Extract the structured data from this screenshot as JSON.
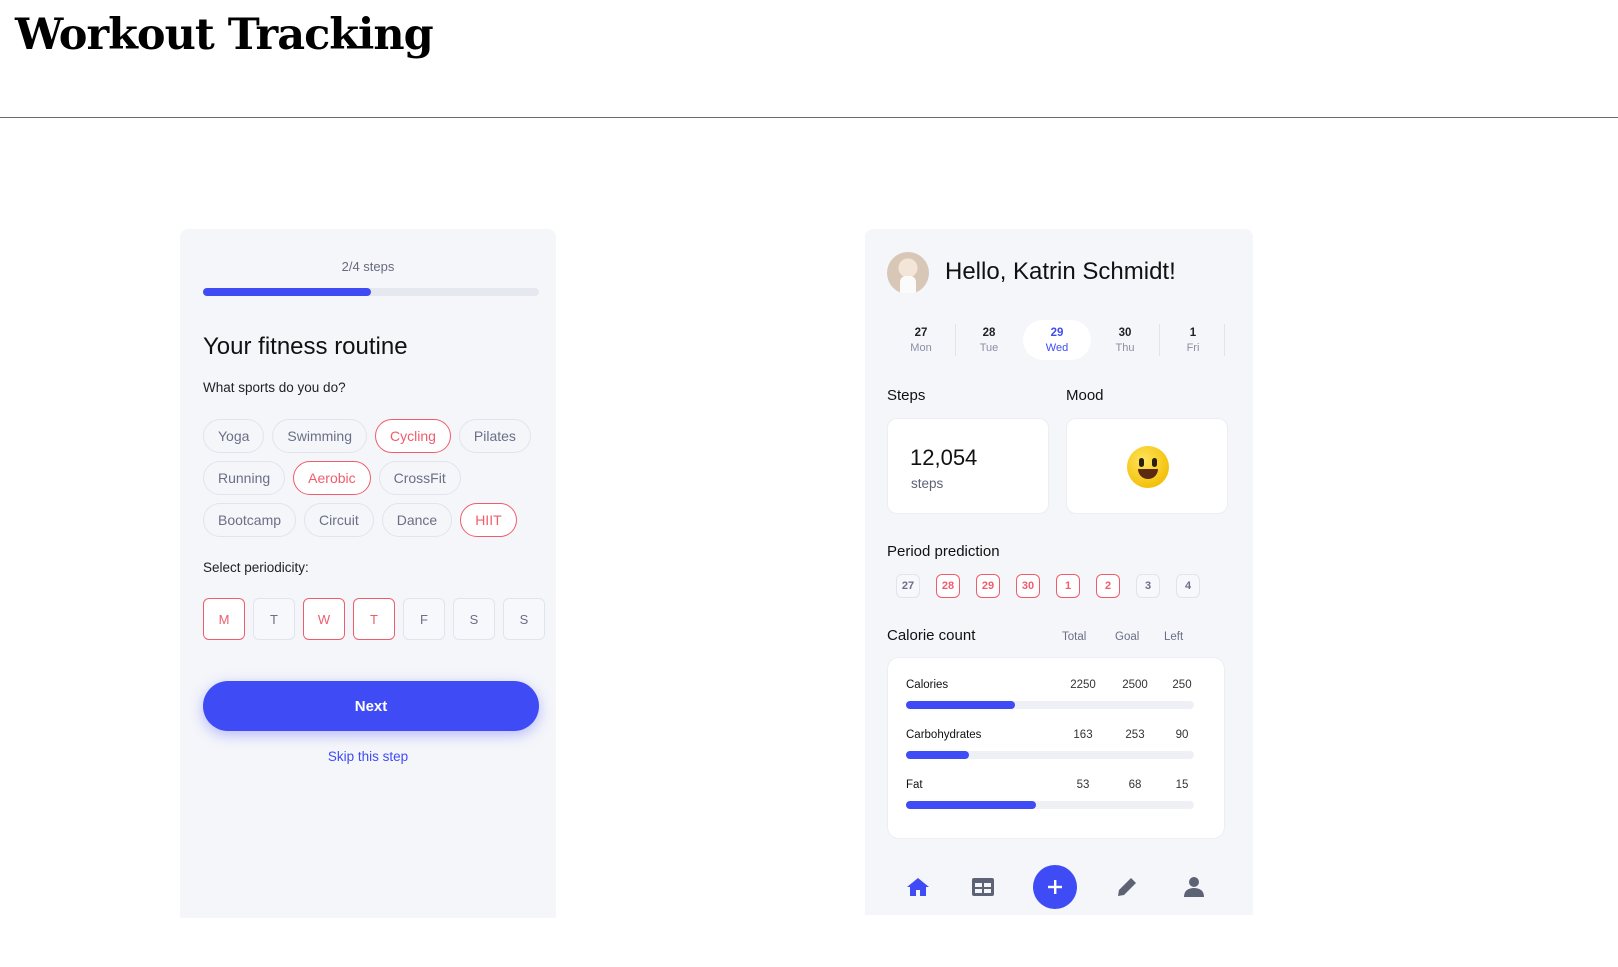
{
  "page": {
    "title": "Workout Tracking"
  },
  "onboarding": {
    "steps_label": "2/4 steps",
    "progress_fraction": 0.5,
    "title": "Your fitness routine",
    "sports_question": "What sports do you do?",
    "sports": [
      [
        {
          "label": "Yoga",
          "selected": false
        },
        {
          "label": "Swimming",
          "selected": false
        },
        {
          "label": "Cycling",
          "selected": true
        },
        {
          "label": "Pilates",
          "selected": false
        }
      ],
      [
        {
          "label": "Running",
          "selected": false
        },
        {
          "label": "Aerobic",
          "selected": true
        },
        {
          "label": "CrossFit",
          "selected": false
        }
      ],
      [
        {
          "label": "Bootcamp",
          "selected": false
        },
        {
          "label": "Circuit",
          "selected": false
        },
        {
          "label": "Dance",
          "selected": false
        },
        {
          "label": "HIIT",
          "selected": true
        }
      ]
    ],
    "periodicity_label": "Select periodicity:",
    "days": [
      {
        "label": "M",
        "selected": true
      },
      {
        "label": "T",
        "selected": false
      },
      {
        "label": "W",
        "selected": true
      },
      {
        "label": "T",
        "selected": true
      },
      {
        "label": "F",
        "selected": false
      },
      {
        "label": "S",
        "selected": false
      },
      {
        "label": "S",
        "selected": false
      }
    ],
    "next_label": "Next",
    "skip_label": "Skip this step"
  },
  "dashboard": {
    "greeting": "Hello, Katrin Schmidt!",
    "week": [
      {
        "num": "27",
        "name": "Mon",
        "active": false
      },
      {
        "num": "28",
        "name": "Tue",
        "active": false
      },
      {
        "num": "29",
        "name": "Wed",
        "active": true
      },
      {
        "num": "30",
        "name": "Thu",
        "active": false
      },
      {
        "num": "1",
        "name": "Fri",
        "active": false
      }
    ],
    "steps_label": "Steps",
    "steps_value": "12,054",
    "steps_unit": "steps",
    "mood_label": "Mood",
    "mood_icon": "smiley-face-icon",
    "period_label": "Period prediction",
    "period_days": [
      {
        "label": "27",
        "selected": false
      },
      {
        "label": "28",
        "selected": true
      },
      {
        "label": "29",
        "selected": true
      },
      {
        "label": "30",
        "selected": true
      },
      {
        "label": "1",
        "selected": true
      },
      {
        "label": "2",
        "selected": true
      },
      {
        "label": "3",
        "selected": false
      },
      {
        "label": "4",
        "selected": false
      }
    ],
    "calorie_label": "Calorie count",
    "calorie_headers": {
      "total": "Total",
      "goal": "Goal",
      "left": "Left"
    },
    "calorie_rows": [
      {
        "name": "Calories",
        "total": "2250",
        "goal": "2500",
        "left": "250",
        "fraction": 0.38
      },
      {
        "name": "Carbohydrates",
        "total": "163",
        "goal": "253",
        "left": "90",
        "fraction": 0.22
      },
      {
        "name": "Fat",
        "total": "53",
        "goal": "68",
        "left": "15",
        "fraction": 0.45
      }
    ],
    "nav_icons": [
      "home-icon",
      "grid-icon",
      "plus-icon",
      "pencil-icon",
      "user-icon"
    ]
  },
  "colors": {
    "accent": "#3f4cf5",
    "selected": "#ef5d6c",
    "card_bg": "#f5f6fa"
  }
}
